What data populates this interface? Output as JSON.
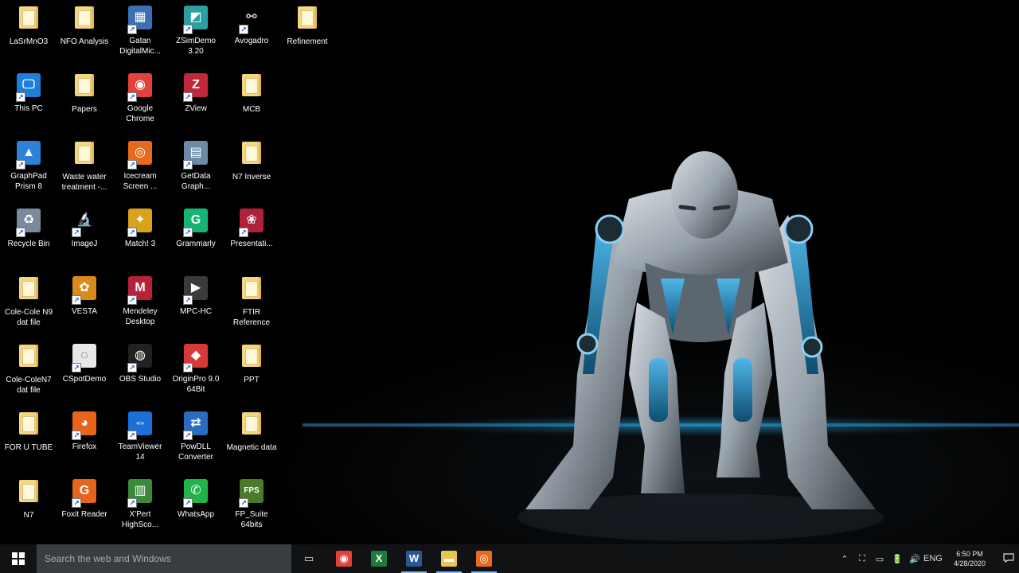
{
  "desktop": {
    "icons": [
      {
        "label": "LaSrMnO3",
        "kind": "folder",
        "col": 0,
        "row": 0
      },
      {
        "label": "NFO Analysis",
        "kind": "folder",
        "col": 1,
        "row": 0
      },
      {
        "label": "Gatan DigitalMic...",
        "kind": "tile",
        "color": "#3b6fb6",
        "glyph": "▦",
        "col": 2,
        "row": 0
      },
      {
        "label": "ZSimDemo 3.20",
        "kind": "tile",
        "color": "#2aa0a0",
        "glyph": "◩",
        "col": 3,
        "row": 0
      },
      {
        "label": "Avogadro",
        "kind": "tile",
        "color": "#000000",
        "glyph": "⚯",
        "col": 4,
        "row": 0
      },
      {
        "label": "Refinement",
        "kind": "folder",
        "col": 5,
        "row": 0
      },
      {
        "label": "This PC",
        "kind": "tile",
        "color": "#1f7fd8",
        "glyph": "🖵",
        "col": 0,
        "row": 1
      },
      {
        "label": "Papers",
        "kind": "folder",
        "col": 1,
        "row": 1
      },
      {
        "label": "Google Chrome",
        "kind": "tile",
        "color": "#e0433a",
        "glyph": "◉",
        "col": 2,
        "row": 1
      },
      {
        "label": "ZView",
        "kind": "tile",
        "color": "#c0283c",
        "glyph": "Z",
        "col": 3,
        "row": 1
      },
      {
        "label": "MCB",
        "kind": "folder",
        "col": 4,
        "row": 1
      },
      {
        "label": "GraphPad Prism 8",
        "kind": "tile",
        "color": "#2b82d6",
        "glyph": "▲",
        "col": 0,
        "row": 2
      },
      {
        "label": "Waste water treatment -...",
        "kind": "folder",
        "col": 1,
        "row": 2
      },
      {
        "label": "Icecream Screen ...",
        "kind": "tile",
        "color": "#e86a1d",
        "glyph": "◎",
        "col": 2,
        "row": 2
      },
      {
        "label": "GetData Graph...",
        "kind": "tile",
        "color": "#6d8aa6",
        "glyph": "▤",
        "col": 3,
        "row": 2
      },
      {
        "label": "N7 Inverse",
        "kind": "folder",
        "col": 4,
        "row": 2
      },
      {
        "label": "Recycle Bin",
        "kind": "tile",
        "color": "#7a8a9a",
        "glyph": "♻",
        "col": 0,
        "row": 3
      },
      {
        "label": "ImageJ",
        "kind": "tile",
        "color": "#000000",
        "glyph": "🔬",
        "col": 1,
        "row": 3
      },
      {
        "label": "Match! 3",
        "kind": "tile",
        "color": "#d8a21c",
        "glyph": "✦",
        "col": 2,
        "row": 3
      },
      {
        "label": "Grammarly",
        "kind": "tile",
        "color": "#15b473",
        "glyph": "G",
        "col": 3,
        "row": 3
      },
      {
        "label": "Presentati...",
        "kind": "tile",
        "color": "#b0203a",
        "glyph": "❀",
        "col": 4,
        "row": 3
      },
      {
        "label": "Cole-Cole N9 dat file",
        "kind": "folder",
        "col": 0,
        "row": 4
      },
      {
        "label": "VESTA",
        "kind": "tile",
        "color": "#d88a1c",
        "glyph": "✿",
        "col": 1,
        "row": 4
      },
      {
        "label": "Mendeley Desktop",
        "kind": "tile",
        "color": "#b7213a",
        "glyph": "M",
        "col": 2,
        "row": 4
      },
      {
        "label": "MPC-HC",
        "kind": "tile",
        "color": "#3a3a3a",
        "glyph": "▶",
        "col": 3,
        "row": 4
      },
      {
        "label": "FTIR Reference",
        "kind": "folder",
        "col": 4,
        "row": 4
      },
      {
        "label": "Cole-ColeN7 dat file",
        "kind": "folder",
        "col": 0,
        "row": 5
      },
      {
        "label": "CSpotDemo",
        "kind": "tile",
        "color": "#e8e8e8",
        "glyph": "◌",
        "col": 1,
        "row": 5
      },
      {
        "label": "OBS Studio",
        "kind": "tile",
        "color": "#222222",
        "glyph": "◍",
        "col": 2,
        "row": 5
      },
      {
        "label": "OriginPro 9.0 64Bit",
        "kind": "tile",
        "color": "#d83a3a",
        "glyph": "◆",
        "col": 3,
        "row": 5
      },
      {
        "label": "PPT",
        "kind": "folder",
        "col": 4,
        "row": 5
      },
      {
        "label": "FOR U TUBE",
        "kind": "folder",
        "col": 0,
        "row": 6
      },
      {
        "label": "Firefox",
        "kind": "tile",
        "color": "#e8641a",
        "glyph": "◕",
        "col": 1,
        "row": 6
      },
      {
        "label": "TeamViewer 14",
        "kind": "tile",
        "color": "#1a6fd8",
        "glyph": "⇔",
        "col": 2,
        "row": 6
      },
      {
        "label": "PowDLL Converter",
        "kind": "tile",
        "color": "#2a6cc0",
        "glyph": "⇄",
        "col": 3,
        "row": 6
      },
      {
        "label": "Magnetic data",
        "kind": "folder",
        "col": 4,
        "row": 6
      },
      {
        "label": "N7",
        "kind": "folder",
        "col": 0,
        "row": 7
      },
      {
        "label": "Foxit Reader",
        "kind": "tile",
        "color": "#e8641a",
        "glyph": "G",
        "col": 1,
        "row": 7
      },
      {
        "label": "X'Pert HighSco...",
        "kind": "tile",
        "color": "#3a8a3a",
        "glyph": "▥",
        "col": 2,
        "row": 7
      },
      {
        "label": "WhatsApp",
        "kind": "tile",
        "color": "#22b24c",
        "glyph": "✆",
        "col": 3,
        "row": 7
      },
      {
        "label": "FP_Suite 64bits",
        "kind": "tile",
        "color": "#4a7a2a",
        "glyph": "FPS",
        "col": 4,
        "row": 7
      }
    ]
  },
  "taskbar": {
    "search_placeholder": "Search the web and Windows",
    "apps": [
      {
        "name": "task-view",
        "glyph": "▭",
        "color": "#dddddd"
      },
      {
        "name": "chrome",
        "glyph": "◉",
        "color": "#e0433a"
      },
      {
        "name": "excel",
        "glyph": "X",
        "color": "#1f7a3e"
      },
      {
        "name": "word",
        "glyph": "W",
        "color": "#2b579a"
      },
      {
        "name": "file-explorer",
        "glyph": "▬",
        "color": "#e8c452"
      },
      {
        "name": "icecream",
        "glyph": "◎",
        "color": "#e86a1d"
      }
    ],
    "tray_glyphs": [
      "⌃",
      "⛶",
      "▭",
      "🔋",
      "🔊",
      "ENG"
    ],
    "time": "6:50 PM",
    "date": "4/28/2020"
  }
}
